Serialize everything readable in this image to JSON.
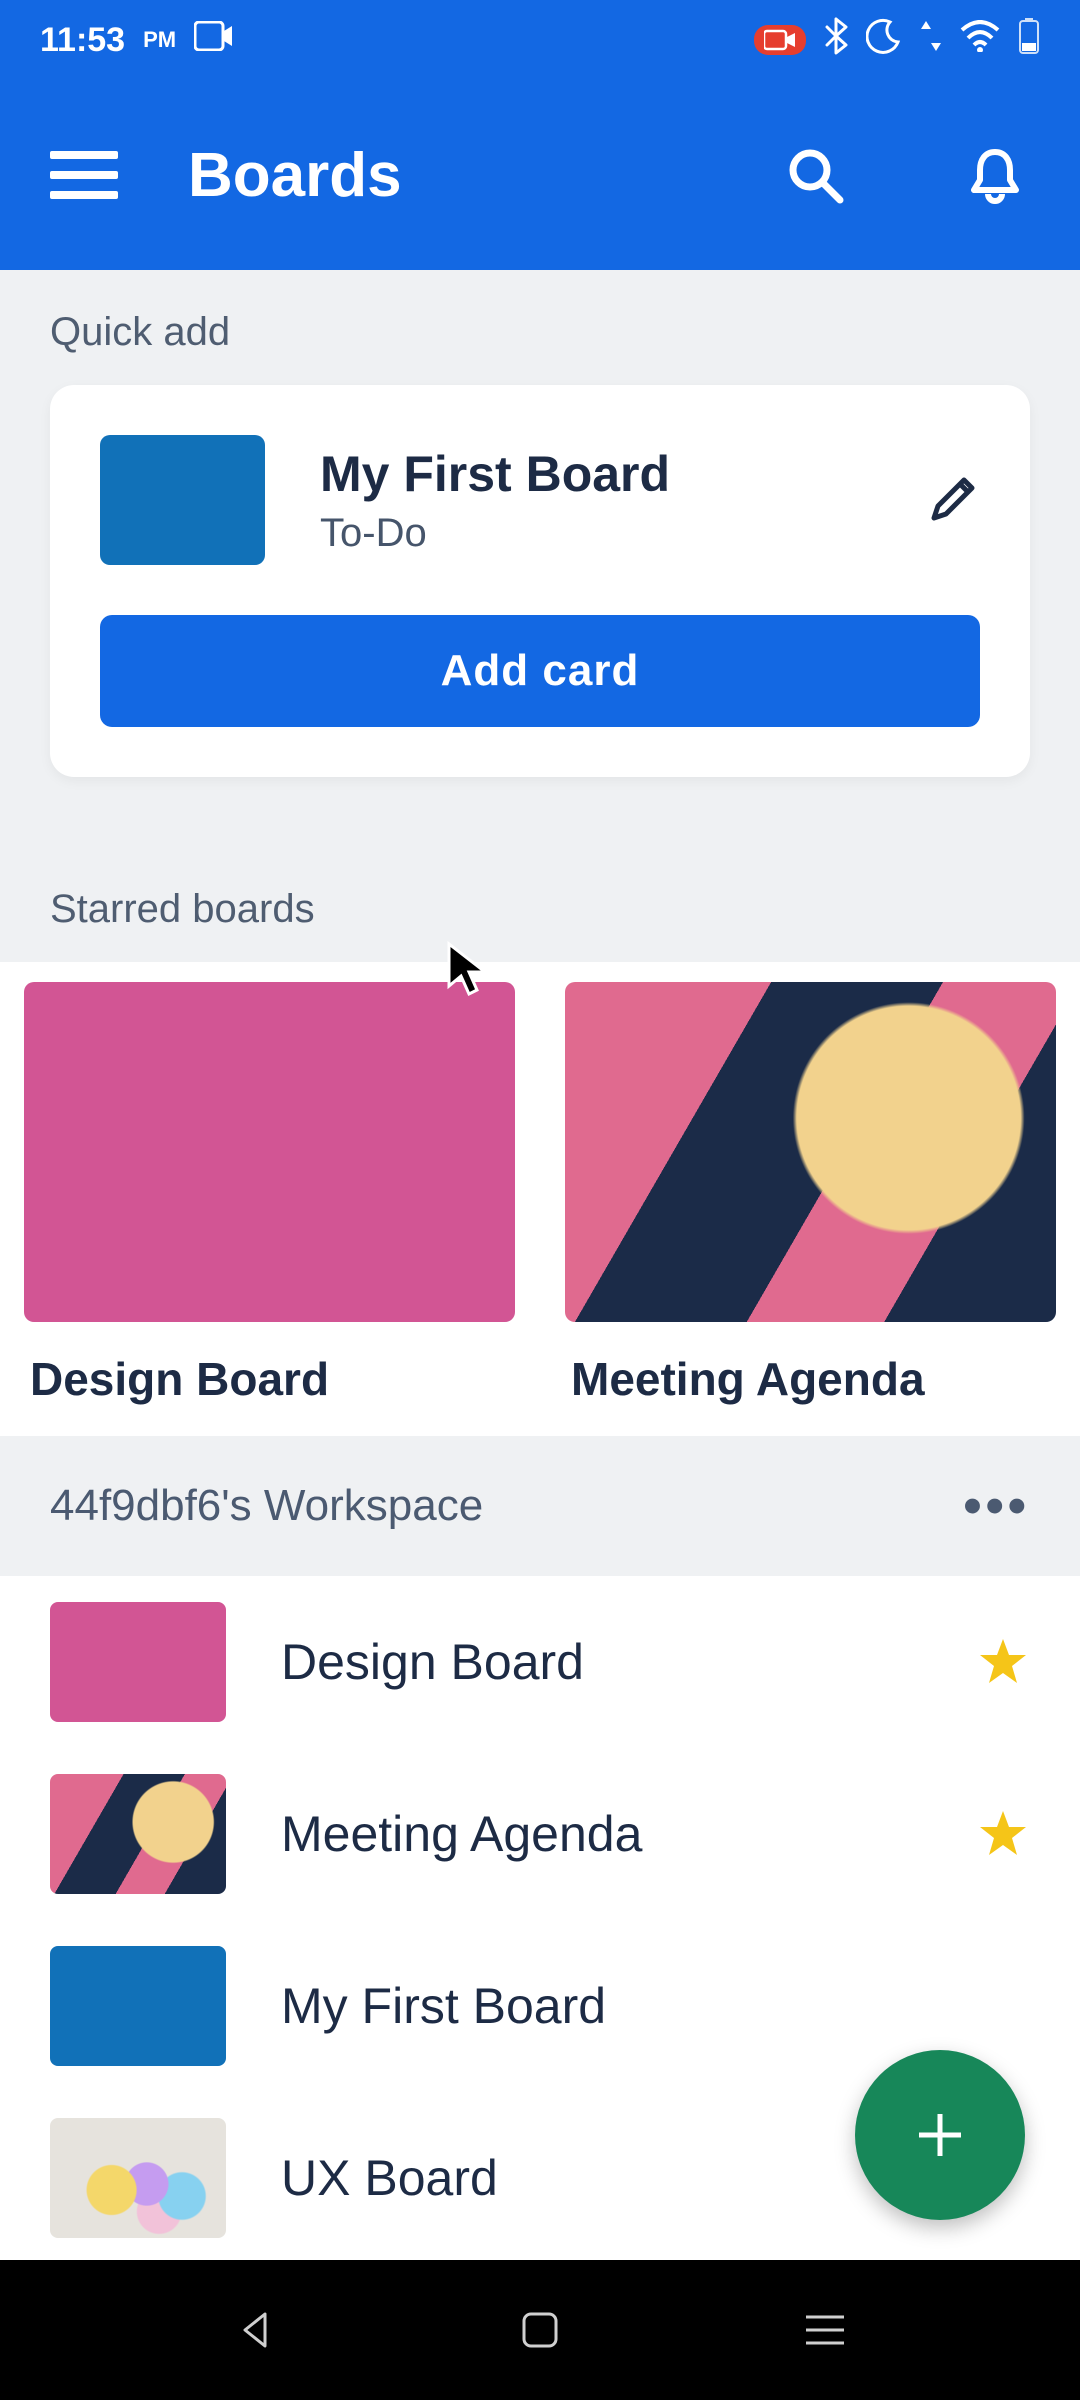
{
  "status": {
    "time": "11:53",
    "ampm": "PM"
  },
  "header": {
    "title": "Boards"
  },
  "quick_add": {
    "label": "Quick add",
    "board_title": "My First Board",
    "board_list": "To-Do",
    "thumb_color": "#1171b8",
    "button_label": "Add card"
  },
  "starred": {
    "label": "Starred boards",
    "items": [
      {
        "title": "Design Board",
        "color": "#d25594"
      },
      {
        "title": "Meeting Agenda",
        "illus": "meeting"
      }
    ]
  },
  "workspace": {
    "name": "44f9dbf6's Workspace",
    "boards": [
      {
        "title": "Design Board",
        "color": "#d25594",
        "starred": true
      },
      {
        "title": "Meeting Agenda",
        "illus": "meeting",
        "starred": true
      },
      {
        "title": "My First Board",
        "color": "#1171b8",
        "starred": false
      },
      {
        "title": "UX Board",
        "illus": "macarons",
        "starred": false
      }
    ]
  },
  "colors": {
    "primary": "#1368e3",
    "fab": "#178759",
    "star": "#f5c518"
  }
}
